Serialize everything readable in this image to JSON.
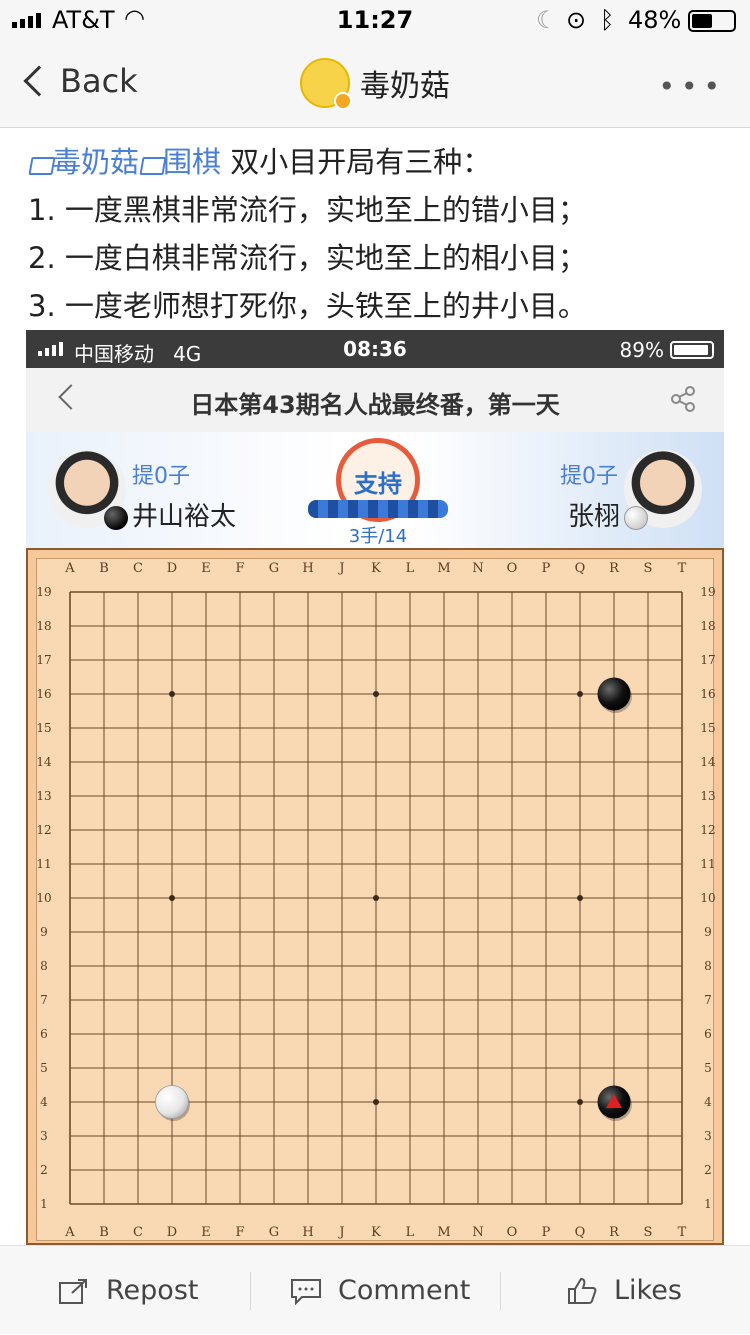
{
  "status_bar": {
    "carrier": "AT&T",
    "time": "11:27",
    "battery": "48%"
  },
  "nav": {
    "back_label": "Back",
    "title": "毒奶菇",
    "more": "•••"
  },
  "post": {
    "tag1": "毒奶菇",
    "tag2": "围棋",
    "intro": "双小目开局有三种：",
    "line1": "1. 一度黑棋非常流行，实地至上的错小目；",
    "line2": "2. 一度白棋非常流行，实地至上的相小目；",
    "line3": "3. 一度老师想打死你，头铁至上的井小目。"
  },
  "embed": {
    "status": {
      "carrier": "中国移动",
      "network": "4G",
      "time": "08:36",
      "battery": "89%"
    },
    "title": "日本第43期名人战最终番，第一天",
    "players": {
      "black": {
        "captured": "提0子",
        "name": "井山裕太"
      },
      "white": {
        "captured": "提0子",
        "name": "张栩"
      }
    },
    "support_label": "支持",
    "move_counter": "3手/14",
    "board": {
      "columns": [
        "A",
        "B",
        "C",
        "D",
        "E",
        "F",
        "G",
        "H",
        "J",
        "K",
        "L",
        "M",
        "N",
        "O",
        "P",
        "Q",
        "R",
        "S",
        "T"
      ],
      "rows": [
        19,
        18,
        17,
        16,
        15,
        14,
        13,
        12,
        11,
        10,
        9,
        8,
        7,
        6,
        5,
        4,
        3,
        2,
        1
      ],
      "stones": [
        {
          "color": "black",
          "col": "R",
          "row": 16,
          "last_move": false
        },
        {
          "color": "black",
          "col": "R",
          "row": 4,
          "last_move": true
        },
        {
          "color": "white",
          "col": "D",
          "row": 4,
          "last_move": false
        }
      ]
    }
  },
  "bottom_bar": {
    "repost": "Repost",
    "comment": "Comment",
    "likes": "Likes"
  },
  "colors": {
    "link": "#4a7fd6",
    "board": "#f9d8b4",
    "last_move_marker": "#e02020"
  }
}
